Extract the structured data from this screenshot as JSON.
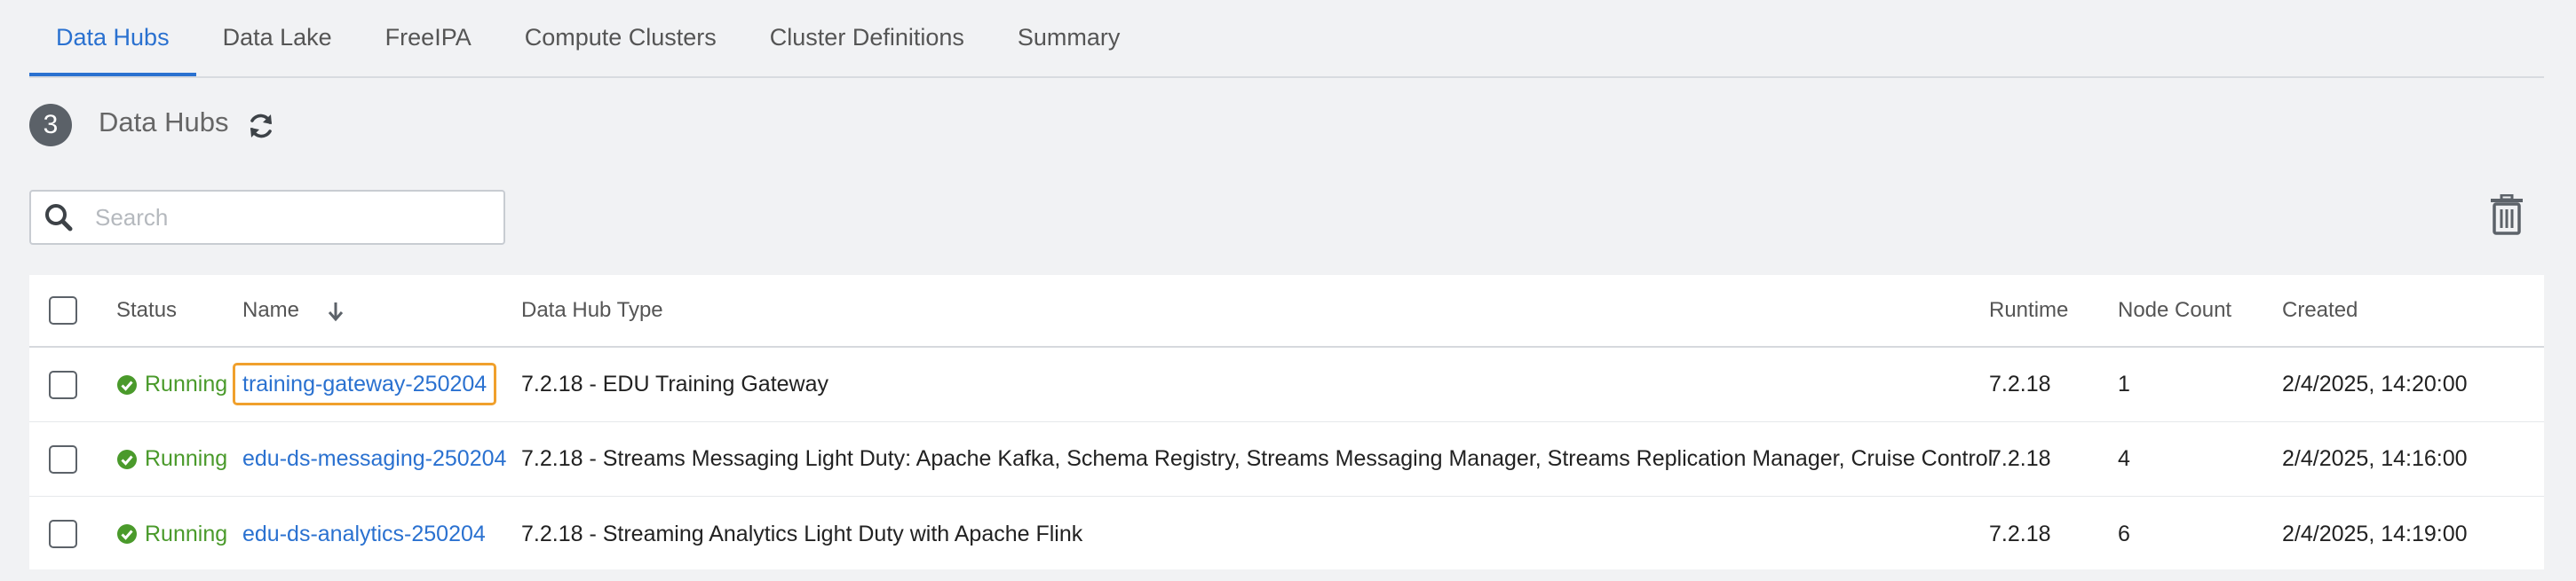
{
  "tabs": [
    {
      "label": "Data Hubs",
      "active": true
    },
    {
      "label": "Data Lake",
      "active": false
    },
    {
      "label": "FreeIPA",
      "active": false
    },
    {
      "label": "Compute Clusters",
      "active": false
    },
    {
      "label": "Cluster Definitions",
      "active": false
    },
    {
      "label": "Summary",
      "active": false
    }
  ],
  "header": {
    "count": "3",
    "title": "Data Hubs"
  },
  "search": {
    "placeholder": "Search",
    "value": ""
  },
  "table": {
    "columns": {
      "status": "Status",
      "name": "Name",
      "type": "Data Hub Type",
      "runtime": "Runtime",
      "node_count": "Node Count",
      "created": "Created"
    },
    "rows": [
      {
        "status": "Running",
        "name": "training-gateway-250204",
        "type": "7.2.18 - EDU Training Gateway",
        "runtime": "7.2.18",
        "node_count": "1",
        "created": "2/4/2025, 14:20:00",
        "highlighted": true
      },
      {
        "status": "Running",
        "name": "edu-ds-messaging-250204",
        "type": "7.2.18 - Streams Messaging Light Duty: Apache Kafka, Schema Registry, Streams Messaging Manager, Streams Replication Manager, Cruise Control",
        "runtime": "7.2.18",
        "node_count": "4",
        "created": "2/4/2025, 14:16:00",
        "highlighted": false
      },
      {
        "status": "Running",
        "name": "edu-ds-analytics-250204",
        "type": "7.2.18 - Streaming Analytics Light Duty with Apache Flink",
        "runtime": "7.2.18",
        "node_count": "6",
        "created": "2/4/2025, 14:19:00",
        "highlighted": false
      }
    ]
  },
  "colors": {
    "accent": "#2a71d0",
    "status_running": "#4a9a2b",
    "highlight_outline": "#f0a02c"
  },
  "icons": {
    "refresh": "refresh-icon",
    "search": "search-icon",
    "trash": "trash-icon",
    "sort": "sort-descending-icon",
    "status": "check-circle-icon"
  }
}
